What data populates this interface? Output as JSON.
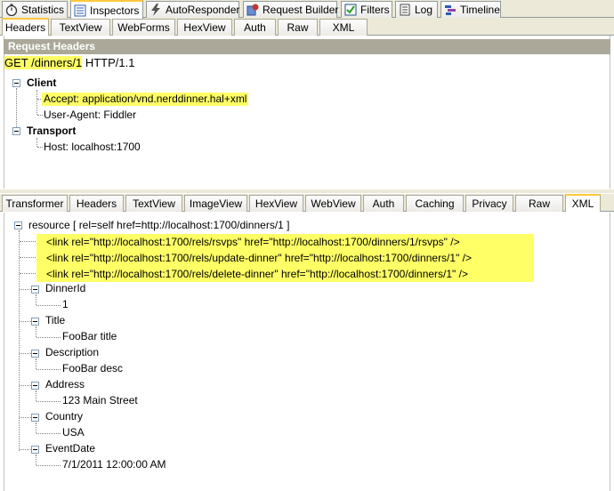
{
  "top_tabs": [
    {
      "label": "Statistics",
      "icon": "stopwatch-icon"
    },
    {
      "label": "Inspectors",
      "icon": "inspector-icon"
    },
    {
      "label": "AutoResponder",
      "icon": "lightning-icon"
    },
    {
      "label": "Request Builder",
      "icon": "builder-icon"
    },
    {
      "label": "Filters",
      "icon": "checkbox-icon"
    },
    {
      "label": "Log",
      "icon": "log-icon"
    },
    {
      "label": "Timeline",
      "icon": "timeline-icon"
    }
  ],
  "request_tabs": [
    "Headers",
    "TextView",
    "WebForms",
    "HexView",
    "Auth",
    "Raw",
    "XML"
  ],
  "request": {
    "section_title": "Request Headers",
    "line_method_path": "GET /dinners/1",
    "line_protocol": " HTTP/1.1",
    "groups": [
      {
        "name": "Client",
        "headers": [
          "Accept: application/vnd.nerddinner.hal+xml",
          "User-Agent: Fiddler"
        ]
      },
      {
        "name": "Transport",
        "headers": [
          "Host: localhost:1700"
        ]
      }
    ]
  },
  "response_tabs": [
    "Transformer",
    "Headers",
    "TextView",
    "ImageView",
    "HexView",
    "WebView",
    "Auth",
    "Caching",
    "Privacy",
    "Raw",
    "XML"
  ],
  "response": {
    "root": "resource [ rel=self href=http://localhost:1700/dinners/1 ]",
    "links": [
      "<link rel=\"http://localhost:1700/rels/rsvps\" href=\"http://localhost:1700/dinners/1/rsvps\" />",
      "<link rel=\"http://localhost:1700/rels/update-dinner\" href=\"http://localhost:1700/dinners/1\" />",
      "<link rel=\"http://localhost:1700/rels/delete-dinner\" href=\"http://localhost:1700/dinners/1\" />"
    ],
    "fields": [
      {
        "name": "DinnerId",
        "value": "1"
      },
      {
        "name": "Title",
        "value": "FooBar title"
      },
      {
        "name": "Description",
        "value": "FooBar desc"
      },
      {
        "name": "Address",
        "value": "123 Main Street"
      },
      {
        "name": "Country",
        "value": "USA"
      },
      {
        "name": "EventDate",
        "value": "7/1/2011 12:00:00 AM"
      }
    ]
  },
  "colors": {
    "highlight": "#ffff66",
    "tab_accent": "#ffc83c",
    "panel_header": "#aca899"
  }
}
